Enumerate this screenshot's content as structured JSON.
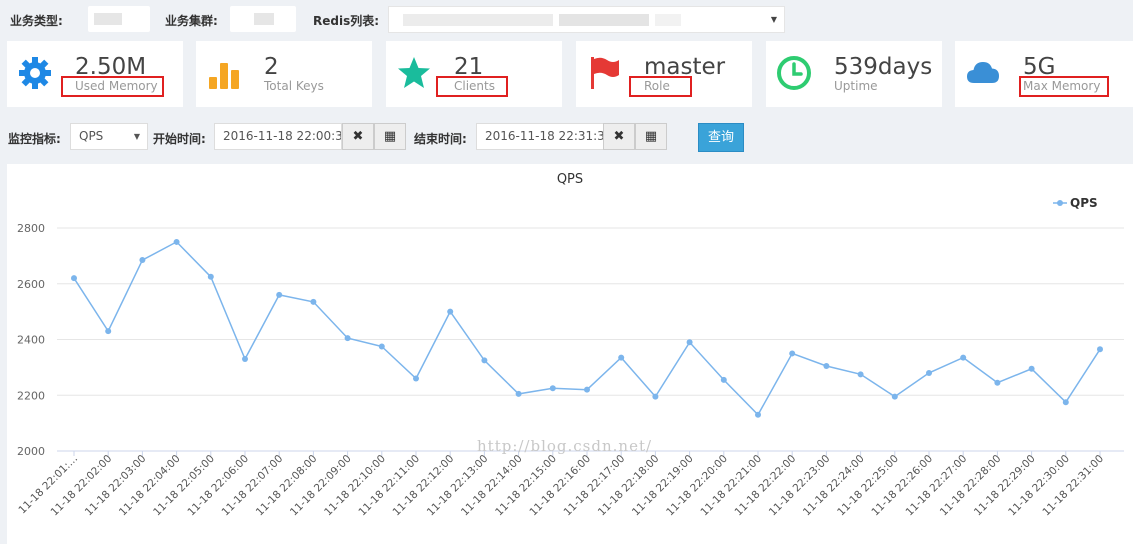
{
  "filters": {
    "biz_type_label": "业务类型:",
    "biz_cluster_label": "业务集群:",
    "redis_list_label": "Redis列表:"
  },
  "stats": [
    {
      "value": "2.50M",
      "label": "Used Memory",
      "icon": "gear-icon",
      "color": "#1e88e5"
    },
    {
      "value": "2",
      "label": "Total Keys",
      "icon": "bar-chart-icon",
      "color": "#f5a623"
    },
    {
      "value": "21",
      "label": "Clients",
      "icon": "star-icon",
      "color": "#1abc9c"
    },
    {
      "value": "master",
      "label": "Role",
      "icon": "flag-icon",
      "color": "#e53935"
    },
    {
      "value": "539days",
      "label": "Uptime",
      "icon": "clock-icon",
      "color": "#2ecc71"
    },
    {
      "value": "5G",
      "label": "Max Memory",
      "icon": "cloud-icon",
      "color": "#3a8fd6"
    }
  ],
  "controls": {
    "metric_label": "监控指标:",
    "metric_value": "QPS",
    "start_label": "开始时间:",
    "start_value": "2016-11-18 22:00:3",
    "end_label": "结束时间:",
    "end_value": "2016-11-18 22:31:3",
    "clear_glyph": "✖",
    "calendar_glyph": "▦",
    "query_label": "查询"
  },
  "watermark": "http://blog.csdn.net/",
  "chart_data": {
    "type": "line",
    "title": "QPS",
    "legend_position": "top-right",
    "xlabel": "",
    "ylabel": "",
    "ylim": [
      2000,
      2800
    ],
    "yticks": [
      2000,
      2200,
      2400,
      2600,
      2800
    ],
    "grid": true,
    "color": "#7cb5ec",
    "categories": [
      "11-18 22:01:…",
      "11-18 22:02:00",
      "11-18 22:03:00",
      "11-18 22:04:00",
      "11-18 22:05:00",
      "11-18 22:06:00",
      "11-18 22:07:00",
      "11-18 22:08:00",
      "11-18 22:09:00",
      "11-18 22:10:00",
      "11-18 22:11:00",
      "11-18 22:12:00",
      "11-18 22:13:00",
      "11-18 22:14:00",
      "11-18 22:15:00",
      "11-18 22:16:00",
      "11-18 22:17:00",
      "11-18 22:18:00",
      "11-18 22:19:00",
      "11-18 22:20:00",
      "11-18 22:21:00",
      "11-18 22:22:00",
      "11-18 22:23:00",
      "11-18 22:24:00",
      "11-18 22:25:00",
      "11-18 22:26:00",
      "11-18 22:27:00",
      "11-18 22:28:00",
      "11-18 22:29:00",
      "11-18 22:30:00",
      "11-18 22:31:00"
    ],
    "series": [
      {
        "name": "QPS",
        "values": [
          2620,
          2430,
          2685,
          2750,
          2625,
          2330,
          2560,
          2535,
          2405,
          2375,
          2260,
          2500,
          2325,
          2205,
          2225,
          2220,
          2335,
          2195,
          2390,
          2255,
          2130,
          2350,
          2305,
          2275,
          2195,
          2280,
          2335,
          2245,
          2295,
          2175,
          2365
        ]
      }
    ]
  }
}
